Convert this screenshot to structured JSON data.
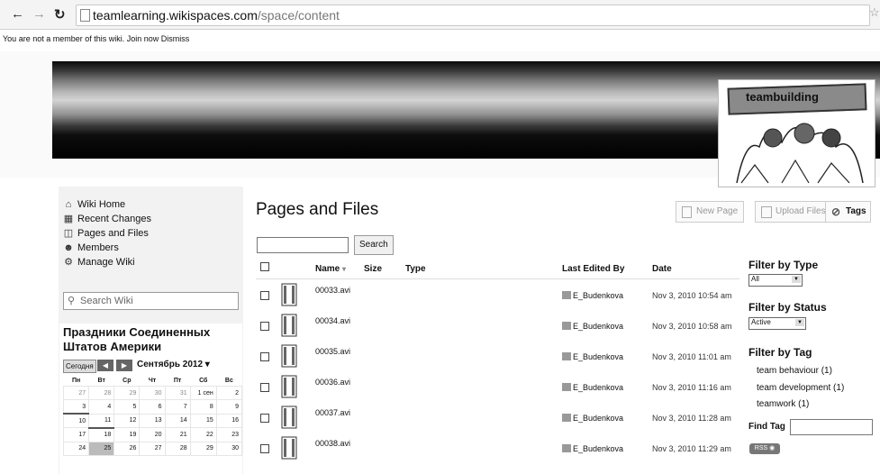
{
  "browser": {
    "url_host": "teamlearning.wikispaces.com",
    "url_path": "/space/content",
    "back_icon": "arrow-left",
    "forward_icon": "arrow-right",
    "reload_icon": "reload",
    "star_icon": "star"
  },
  "notice": {
    "text": "You are not a member of this wiki.",
    "join_label": "Join now",
    "dismiss_label": "Dismiss"
  },
  "logo": {
    "text": "teambuilding"
  },
  "sidebar": {
    "nav": [
      {
        "label": "Wiki Home",
        "icon": "home-icon"
      },
      {
        "label": "Recent Changes",
        "icon": "calendar-icon"
      },
      {
        "label": "Pages and Files",
        "icon": "pages-icon"
      },
      {
        "label": "Members",
        "icon": "members-icon"
      },
      {
        "label": "Manage Wiki",
        "icon": "gear-icon"
      }
    ],
    "search_placeholder": "Search Wiki",
    "calendar": {
      "title": "Праздники Соединенных Штатов Америки",
      "today_label": "Сегодня",
      "month_label": "Сентябрь 2012",
      "weekdays": [
        "Пн",
        "Вт",
        "Ср",
        "Чт",
        "Пт",
        "Сб",
        "Вс"
      ],
      "weeks": [
        [
          "27",
          "28",
          "29",
          "30",
          "31",
          "1 сен",
          "2"
        ],
        [
          "3",
          "4",
          "5",
          "6",
          "7",
          "8",
          "9"
        ],
        [
          "10",
          "11",
          "12",
          "13",
          "14",
          "15",
          "16"
        ],
        [
          "17",
          "18",
          "19",
          "20",
          "21",
          "22",
          "23"
        ],
        [
          "24",
          "25",
          "26",
          "27",
          "28",
          "29",
          "30"
        ]
      ]
    }
  },
  "main": {
    "title": "Pages and Files",
    "search_button": "Search",
    "toolbar": {
      "new_page": "New Page",
      "upload_files": "Upload Files",
      "tags": "Tags"
    },
    "columns": {
      "name": "Name",
      "size": "Size",
      "type": "Type",
      "last_edited_by": "Last Edited By",
      "date": "Date"
    },
    "rows": [
      {
        "name": "00033.avi",
        "editor": "E_Budenkova",
        "date": "Nov 3, 2010 10:54 am"
      },
      {
        "name": "00034.avi",
        "editor": "E_Budenkova",
        "date": "Nov 3, 2010 10:58 am"
      },
      {
        "name": "00035.avi",
        "editor": "E_Budenkova",
        "date": "Nov 3, 2010 11:01 am"
      },
      {
        "name": "00036.avi",
        "editor": "E_Budenkova",
        "date": "Nov 3, 2010 11:16 am"
      },
      {
        "name": "00037.avi",
        "editor": "E_Budenkova",
        "date": "Nov 3, 2010 11:28 am"
      },
      {
        "name": "00038.avi",
        "editor": "E_Budenkova",
        "date": "Nov 3, 2010 11:29 am"
      }
    ]
  },
  "filters": {
    "by_type_title": "Filter by Type",
    "by_type_value": "All",
    "by_status_title": "Filter by Status",
    "by_status_value": "Active",
    "by_tag_title": "Filter by Tag",
    "tags": [
      "team behaviour (1)",
      "team development (1)",
      "teamwork (1)"
    ],
    "find_tag_label": "Find Tag",
    "rss_label": "RSS"
  }
}
